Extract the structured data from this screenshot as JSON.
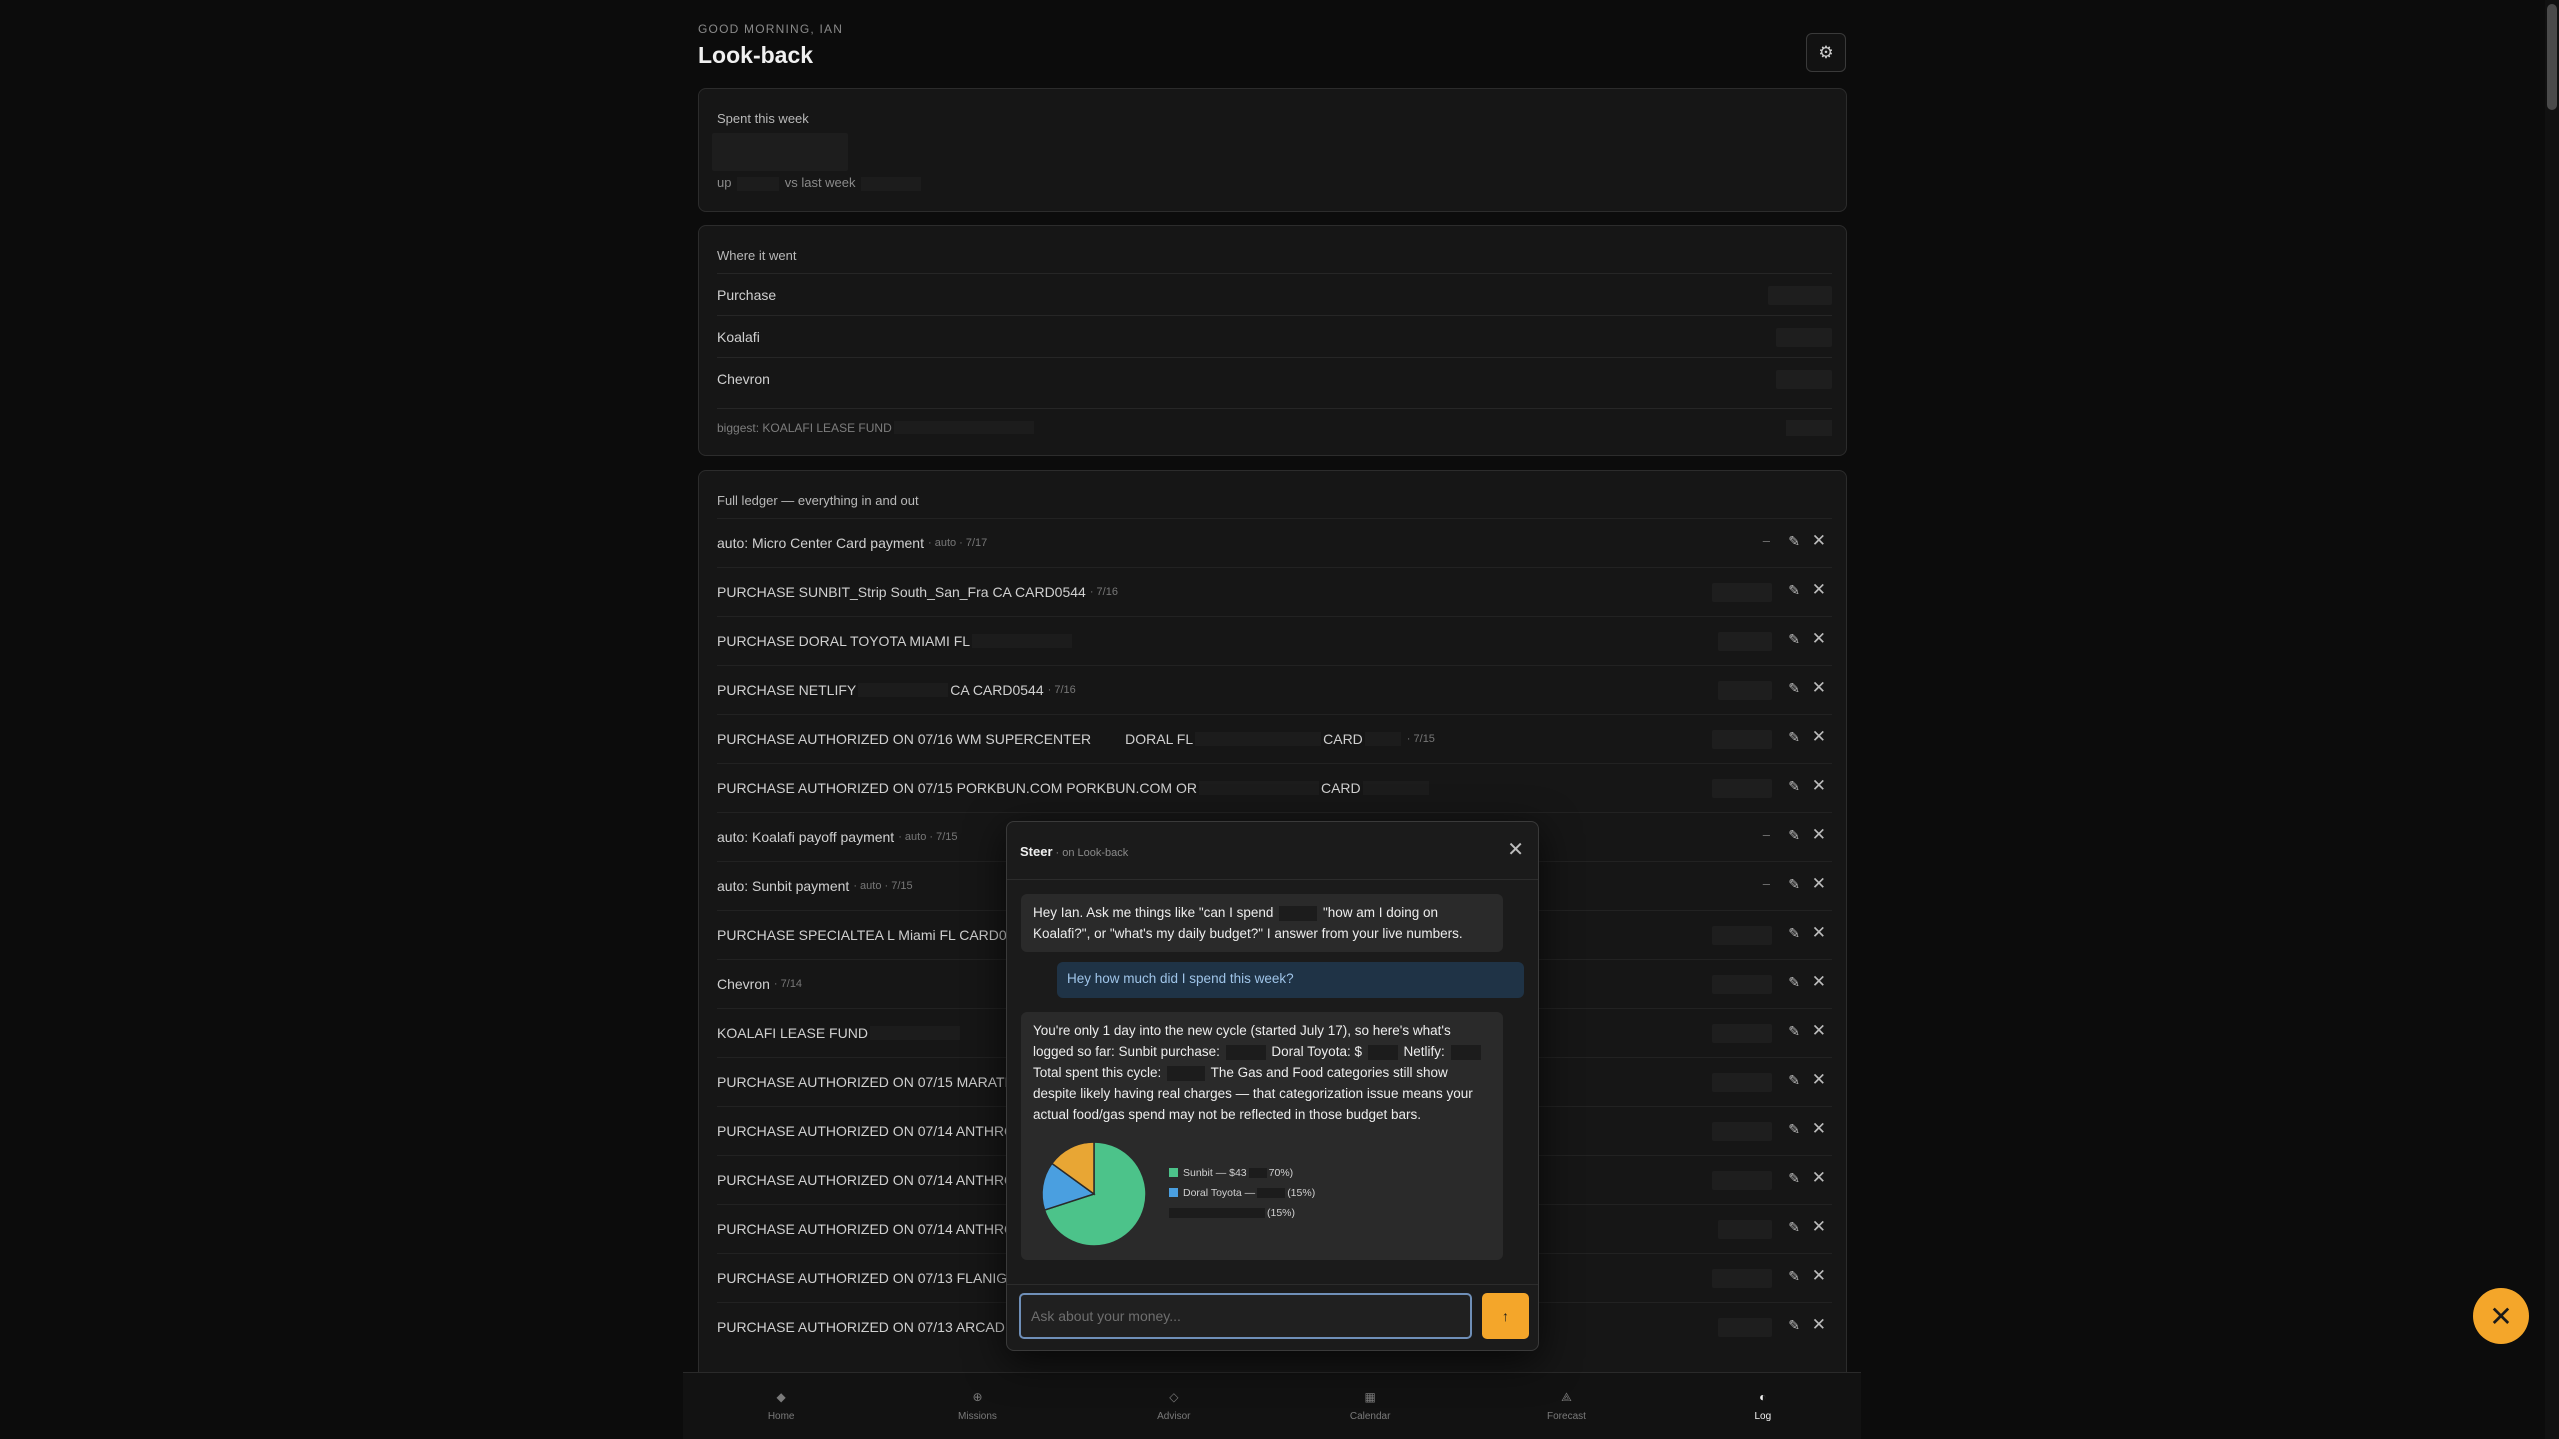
{
  "header": {
    "greeting": "GOOD MORNING, IAN",
    "title": "Look-back",
    "settings_icon": "gear-icon"
  },
  "spent": {
    "label": "Spent this week",
    "sub_prefix": "up",
    "sub_suffix": "vs last week"
  },
  "where": {
    "label": "Where it went",
    "rows": [
      "Purchase",
      "Koalafi",
      "Chevron"
    ],
    "biggest": "biggest: KOALAFI LEASE FUND"
  },
  "ledger": {
    "label": "Full ledger — everything in and out",
    "rows": [
      {
        "text": "auto: Micro Center Card payment",
        "meta": "· auto · 7/17",
        "dash": "–"
      },
      {
        "text": "PURCHASE SUNBIT_Strip South_San_Fra CA CARD0544",
        "meta": "· 7/16",
        "dash": ""
      },
      {
        "text": "PURCHASE DORAL TOYOTA MIAMI FL",
        "meta": "",
        "dash": ""
      },
      {
        "text": "PURCHASE NETLIFY",
        "text2": "CA CARD0544",
        "meta": "· 7/16",
        "dash": ""
      },
      {
        "text": "PURCHASE AUTHORIZED ON 07/16 WM SUPERCENTER",
        "text2": "DORAL FL",
        "text3": "CARD",
        "meta": "· 7/15",
        "dash": ""
      },
      {
        "text": "PURCHASE AUTHORIZED ON 07/15 PORKBUN.COM PORKBUN.COM OR",
        "text2": "CARD",
        "meta": "",
        "dash": ""
      },
      {
        "text": "auto: Koalafi payoff payment",
        "meta": "· auto · 7/15",
        "dash": "–"
      },
      {
        "text": "auto: Sunbit payment",
        "meta": "· auto · 7/15",
        "dash": "–"
      },
      {
        "text": "PURCHASE SPECIALTEA L Miami FL CARD0544",
        "meta": "",
        "dash": ""
      },
      {
        "text": "Chevron",
        "meta": "· 7/14",
        "dash": ""
      },
      {
        "text": "KOALAFI LEASE FUND",
        "meta": "",
        "dash": ""
      },
      {
        "text": "PURCHASE AUTHORIZED ON 07/15 MARATHO",
        "meta": "",
        "dash": ""
      },
      {
        "text": "PURCHASE AUTHORIZED ON 07/14 ANTHROP",
        "meta": "",
        "dash": ""
      },
      {
        "text": "PURCHASE AUTHORIZED ON 07/14 ANTHROP",
        "meta": "",
        "dash": ""
      },
      {
        "text": "PURCHASE AUTHORIZED ON 07/14 ANTHROP",
        "meta": "",
        "dash": ""
      },
      {
        "text": "PURCHASE AUTHORIZED ON 07/13 FLANIGAN",
        "meta": "",
        "dash": ""
      },
      {
        "text": "PURCHASE AUTHORIZED ON 07/13 ARCADE T",
        "meta": "",
        "dash": ""
      }
    ]
  },
  "chat": {
    "title": "Steer",
    "subtitle": "· on Look-back",
    "close_icon": "close-icon",
    "greeting_msg_a": "Hey Ian. Ask me things like \"can I spend",
    "greeting_msg_b": "\"how am I doing on Koalafi?\", or \"what's my daily budget?\" I answer from your live numbers.",
    "user_msg": "Hey how much did I spend this week?",
    "reply_a": "You're only 1 day into the new cycle (started July 17), so here's what's logged so far: Sunbit purchase:",
    "reply_b": "Doral Toyota: $",
    "reply_c": "Netlify:",
    "reply_d": "Total spent this cycle:",
    "reply_e": "The Gas and Food categories still show despite likely having real charges — that categorization issue means your actual food/gas spend may not be reflected in those budget bars.",
    "legend": [
      {
        "label": "Sunbit — $43",
        "pct": "70%)",
        "color": "#4cc38a"
      },
      {
        "label": "Doral Toyota —",
        "pct": "(15%)",
        "color": "#4a9fe0"
      },
      {
        "label": "",
        "pct": "(15%)",
        "color": "#e8a634"
      }
    ],
    "input_placeholder": "Ask about your money...",
    "send_label": "↑"
  },
  "chart_data": {
    "type": "pie",
    "categories": [
      "Sunbit",
      "Doral Toyota",
      "Netlify"
    ],
    "values": [
      70,
      15,
      15
    ]
  },
  "nav": {
    "items": [
      {
        "label": "Home",
        "icon": "◆"
      },
      {
        "label": "Missions",
        "icon": "⊕"
      },
      {
        "label": "Advisor",
        "icon": "◇"
      },
      {
        "label": "Calendar",
        "icon": "▦"
      },
      {
        "label": "Forecast",
        "icon": "⟁"
      },
      {
        "label": "Log",
        "icon": "◐"
      }
    ]
  },
  "fab_close": "✕"
}
